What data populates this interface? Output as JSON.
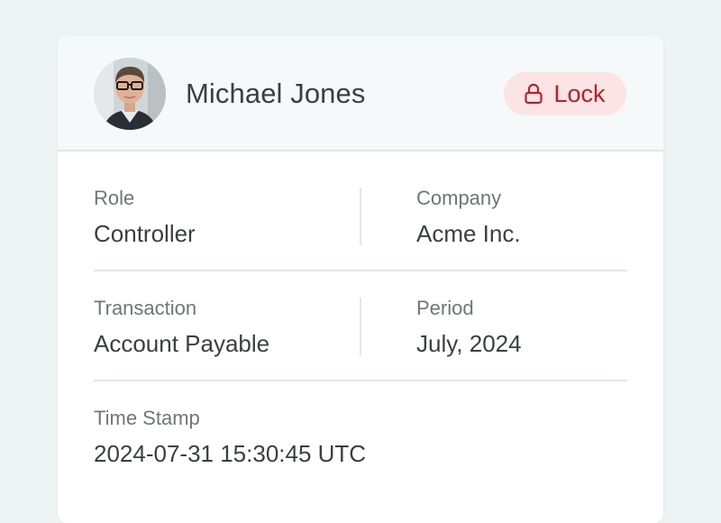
{
  "user": {
    "name": "Michael Jones",
    "avatar_icon": "user-photo-avatar"
  },
  "lock_button": {
    "label": "Lock",
    "icon": "lock-icon",
    "color": "#b4232c",
    "background": "#fde4e4"
  },
  "details": {
    "role": {
      "label": "Role",
      "value": "Controller"
    },
    "company": {
      "label": "Company",
      "value": "Acme Inc."
    },
    "transaction": {
      "label": "Transaction",
      "value": "Account Payable"
    },
    "period": {
      "label": "Period",
      "value": "July, 2024"
    },
    "timestamp": {
      "label": "Time Stamp",
      "value": "2024-07-31 15:30:45 UTC"
    }
  }
}
